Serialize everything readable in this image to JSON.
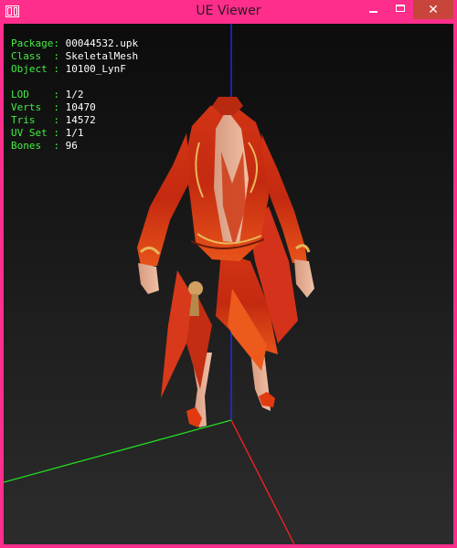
{
  "window": {
    "title": "UE Viewer",
    "accent_color": "#ff2d8c",
    "close_button_color": "#c7453b",
    "icons": [
      "app-icon",
      "minimize-icon",
      "maximize-icon",
      "close-icon"
    ]
  },
  "info": {
    "package": {
      "label": "Package:",
      "value": "00044532.upk"
    },
    "class": {
      "label": "Class  :",
      "value": "SkeletalMesh"
    },
    "object": {
      "label": "Object :",
      "value": "10100_LynF"
    },
    "lod": {
      "label": "LOD    :",
      "value": "1/2"
    },
    "verts": {
      "label": "Verts  :",
      "value": "10470"
    },
    "tris": {
      "label": "Tris   :",
      "value": "14572"
    },
    "uvset": {
      "label": "UV Set :",
      "value": "1/1"
    },
    "bones": {
      "label": "Bones  :",
      "value": "96"
    }
  },
  "viewport": {
    "axis_colors": {
      "x": "#ff2020",
      "y": "#22dd22",
      "z": "#2030ff"
    }
  }
}
